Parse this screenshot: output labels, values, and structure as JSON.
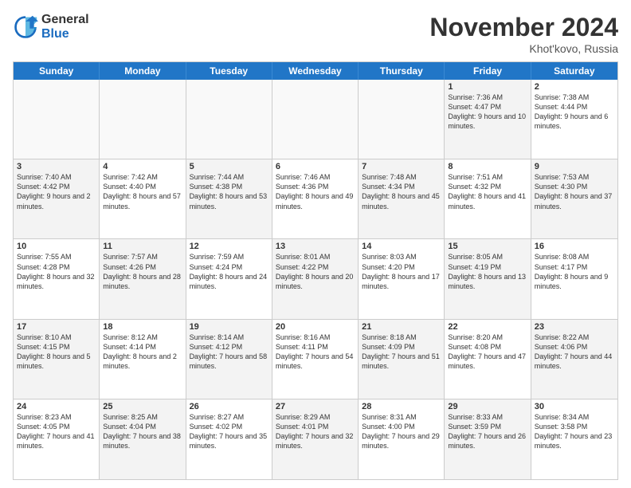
{
  "logo": {
    "general": "General",
    "blue": "Blue"
  },
  "title": "November 2024",
  "location": "Khot'kovo, Russia",
  "weekdays": [
    "Sunday",
    "Monday",
    "Tuesday",
    "Wednesday",
    "Thursday",
    "Friday",
    "Saturday"
  ],
  "rows": [
    [
      {
        "day": "",
        "text": "",
        "empty": true
      },
      {
        "day": "",
        "text": "",
        "empty": true
      },
      {
        "day": "",
        "text": "",
        "empty": true
      },
      {
        "day": "",
        "text": "",
        "empty": true
      },
      {
        "day": "",
        "text": "",
        "empty": true
      },
      {
        "day": "1",
        "text": "Sunrise: 7:36 AM\nSunset: 4:47 PM\nDaylight: 9 hours and 10 minutes.",
        "shaded": true
      },
      {
        "day": "2",
        "text": "Sunrise: 7:38 AM\nSunset: 4:44 PM\nDaylight: 9 hours and 6 minutes.",
        "shaded": false
      }
    ],
    [
      {
        "day": "3",
        "text": "Sunrise: 7:40 AM\nSunset: 4:42 PM\nDaylight: 9 hours and 2 minutes.",
        "shaded": true
      },
      {
        "day": "4",
        "text": "Sunrise: 7:42 AM\nSunset: 4:40 PM\nDaylight: 8 hours and 57 minutes.",
        "shaded": false
      },
      {
        "day": "5",
        "text": "Sunrise: 7:44 AM\nSunset: 4:38 PM\nDaylight: 8 hours and 53 minutes.",
        "shaded": true
      },
      {
        "day": "6",
        "text": "Sunrise: 7:46 AM\nSunset: 4:36 PM\nDaylight: 8 hours and 49 minutes.",
        "shaded": false
      },
      {
        "day": "7",
        "text": "Sunrise: 7:48 AM\nSunset: 4:34 PM\nDaylight: 8 hours and 45 minutes.",
        "shaded": true
      },
      {
        "day": "8",
        "text": "Sunrise: 7:51 AM\nSunset: 4:32 PM\nDaylight: 8 hours and 41 minutes.",
        "shaded": false
      },
      {
        "day": "9",
        "text": "Sunrise: 7:53 AM\nSunset: 4:30 PM\nDaylight: 8 hours and 37 minutes.",
        "shaded": true
      }
    ],
    [
      {
        "day": "10",
        "text": "Sunrise: 7:55 AM\nSunset: 4:28 PM\nDaylight: 8 hours and 32 minutes.",
        "shaded": false
      },
      {
        "day": "11",
        "text": "Sunrise: 7:57 AM\nSunset: 4:26 PM\nDaylight: 8 hours and 28 minutes.",
        "shaded": true
      },
      {
        "day": "12",
        "text": "Sunrise: 7:59 AM\nSunset: 4:24 PM\nDaylight: 8 hours and 24 minutes.",
        "shaded": false
      },
      {
        "day": "13",
        "text": "Sunrise: 8:01 AM\nSunset: 4:22 PM\nDaylight: 8 hours and 20 minutes.",
        "shaded": true
      },
      {
        "day": "14",
        "text": "Sunrise: 8:03 AM\nSunset: 4:20 PM\nDaylight: 8 hours and 17 minutes.",
        "shaded": false
      },
      {
        "day": "15",
        "text": "Sunrise: 8:05 AM\nSunset: 4:19 PM\nDaylight: 8 hours and 13 minutes.",
        "shaded": true
      },
      {
        "day": "16",
        "text": "Sunrise: 8:08 AM\nSunset: 4:17 PM\nDaylight: 8 hours and 9 minutes.",
        "shaded": false
      }
    ],
    [
      {
        "day": "17",
        "text": "Sunrise: 8:10 AM\nSunset: 4:15 PM\nDaylight: 8 hours and 5 minutes.",
        "shaded": true
      },
      {
        "day": "18",
        "text": "Sunrise: 8:12 AM\nSunset: 4:14 PM\nDaylight: 8 hours and 2 minutes.",
        "shaded": false
      },
      {
        "day": "19",
        "text": "Sunrise: 8:14 AM\nSunset: 4:12 PM\nDaylight: 7 hours and 58 minutes.",
        "shaded": true
      },
      {
        "day": "20",
        "text": "Sunrise: 8:16 AM\nSunset: 4:11 PM\nDaylight: 7 hours and 54 minutes.",
        "shaded": false
      },
      {
        "day": "21",
        "text": "Sunrise: 8:18 AM\nSunset: 4:09 PM\nDaylight: 7 hours and 51 minutes.",
        "shaded": true
      },
      {
        "day": "22",
        "text": "Sunrise: 8:20 AM\nSunset: 4:08 PM\nDaylight: 7 hours and 47 minutes.",
        "shaded": false
      },
      {
        "day": "23",
        "text": "Sunrise: 8:22 AM\nSunset: 4:06 PM\nDaylight: 7 hours and 44 minutes.",
        "shaded": true
      }
    ],
    [
      {
        "day": "24",
        "text": "Sunrise: 8:23 AM\nSunset: 4:05 PM\nDaylight: 7 hours and 41 minutes.",
        "shaded": false
      },
      {
        "day": "25",
        "text": "Sunrise: 8:25 AM\nSunset: 4:04 PM\nDaylight: 7 hours and 38 minutes.",
        "shaded": true
      },
      {
        "day": "26",
        "text": "Sunrise: 8:27 AM\nSunset: 4:02 PM\nDaylight: 7 hours and 35 minutes.",
        "shaded": false
      },
      {
        "day": "27",
        "text": "Sunrise: 8:29 AM\nSunset: 4:01 PM\nDaylight: 7 hours and 32 minutes.",
        "shaded": true
      },
      {
        "day": "28",
        "text": "Sunrise: 8:31 AM\nSunset: 4:00 PM\nDaylight: 7 hours and 29 minutes.",
        "shaded": false
      },
      {
        "day": "29",
        "text": "Sunrise: 8:33 AM\nSunset: 3:59 PM\nDaylight: 7 hours and 26 minutes.",
        "shaded": true
      },
      {
        "day": "30",
        "text": "Sunrise: 8:34 AM\nSunset: 3:58 PM\nDaylight: 7 hours and 23 minutes.",
        "shaded": false
      }
    ]
  ]
}
